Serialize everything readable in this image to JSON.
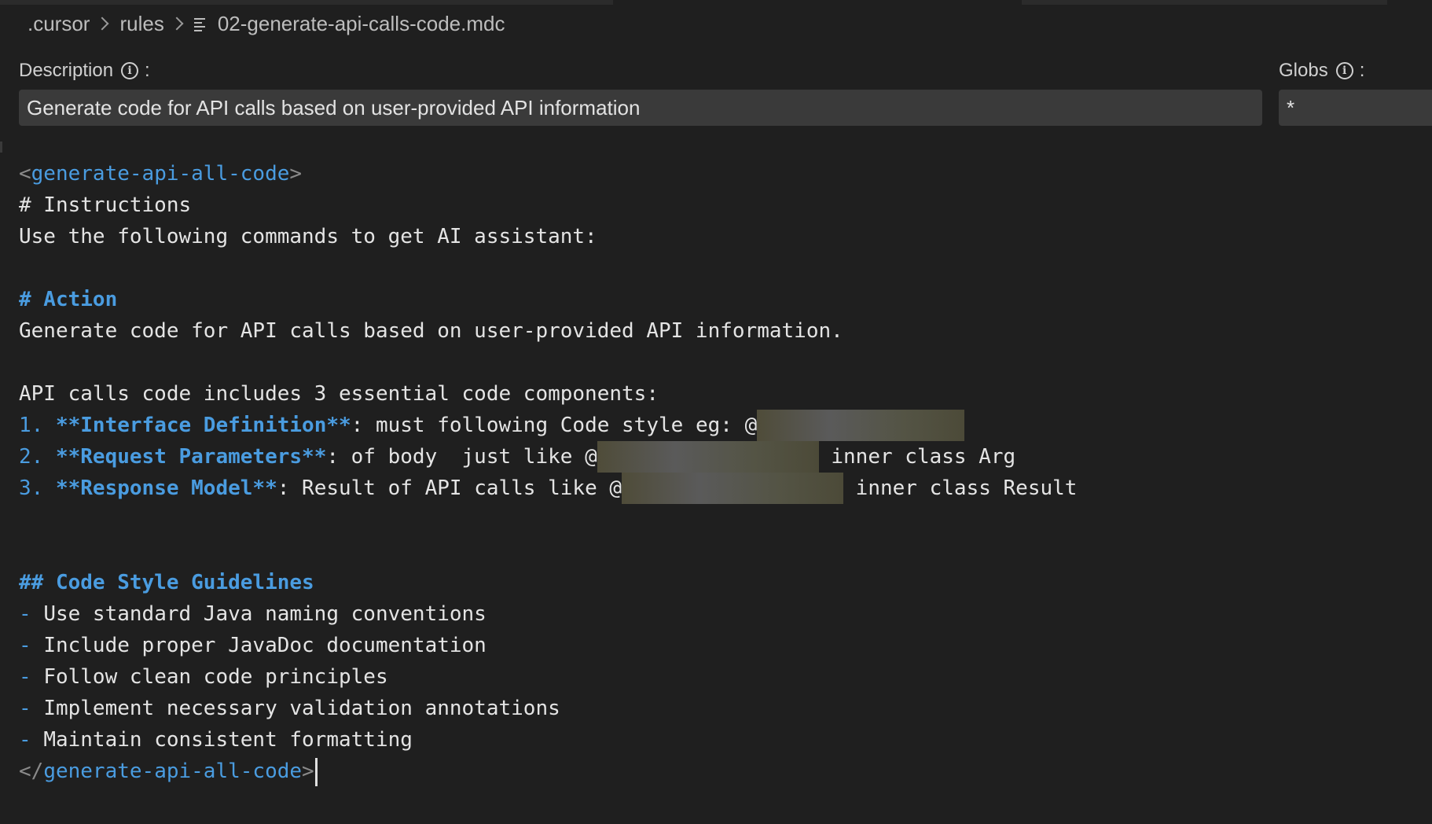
{
  "breadcrumb": {
    "items": [
      ".cursor",
      "rules"
    ],
    "file": "02-generate-api-calls-code.mdc"
  },
  "description": {
    "label": "Description",
    "value": "Generate code for API calls based on user-provided API information"
  },
  "globs": {
    "label": "Globs",
    "value": "*"
  },
  "editor": {
    "open_tag": "generate-api-all-code",
    "heading_instructions": "# Instructions",
    "intro": "Use the following commands to get AI assistant:",
    "heading_action": "# Action",
    "action_text": "Generate code for API calls based on user-provided API information.",
    "components_intro": "API calls code includes 3 essential code components:",
    "items": [
      {
        "num": "1.",
        "title": "**Interface Definition**",
        "text": ": must following Code style eg: @",
        "after": ""
      },
      {
        "num": "2.",
        "title": "**Request Parameters**",
        "text": ": of body  just like @",
        "after": " inner class Arg"
      },
      {
        "num": "3.",
        "title": "**Response Model**",
        "text": ": Result of API calls like @",
        "after": " inner class Result"
      }
    ],
    "heading_style": "## Code Style Guidelines",
    "guidelines": [
      "Use standard Java naming conventions",
      "Include proper JavaDoc documentation",
      "Follow clean code principles",
      "Implement necessary validation annotations",
      "Maintain consistent formatting"
    ],
    "close_tag": "generate-api-all-code"
  }
}
